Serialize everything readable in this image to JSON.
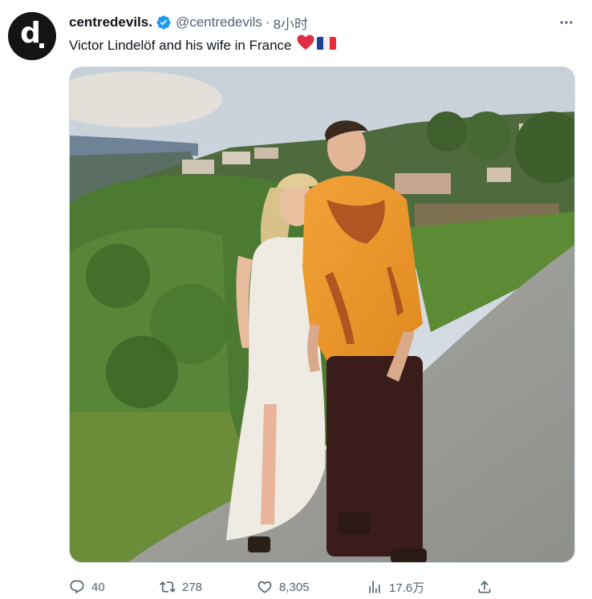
{
  "author": {
    "display_name": "centredevils.",
    "handle": "@centredevils",
    "separator": "·",
    "time": "8小时",
    "avatar_letter": "d",
    "verified_icon": "verified-badge-icon",
    "verified_color": "#1d9bf0"
  },
  "tweet": {
    "text": "Victor Lindelöf and his wife in France",
    "emojis": [
      "red-heart-emoji",
      "france-flag-emoji"
    ]
  },
  "media": {
    "kind": "photo",
    "subject": "couple standing on a hillside path"
  },
  "actions": {
    "reply": {
      "icon": "reply-icon",
      "count": "40"
    },
    "retweet": {
      "icon": "retweet-icon",
      "count": "278"
    },
    "like": {
      "icon": "heart-icon",
      "count": "8,305"
    },
    "views": {
      "icon": "analytics-icon",
      "count": "17.6万"
    },
    "share": {
      "icon": "share-icon"
    }
  },
  "colors": {
    "text_primary": "#0f1419",
    "text_secondary": "#536471",
    "border": "#cfd9de",
    "accent": "#1d9bf0"
  }
}
